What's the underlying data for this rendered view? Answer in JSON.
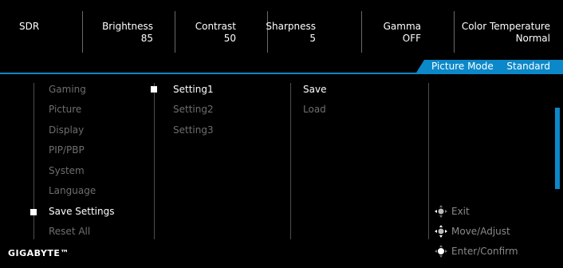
{
  "top_bar": {
    "sdr": "SDR",
    "items": [
      {
        "label": "Brightness",
        "value": "85"
      },
      {
        "label": "Contrast",
        "value": "50"
      },
      {
        "label": "Sharpness",
        "value": "5"
      },
      {
        "label": "Gamma",
        "value": "OFF"
      },
      {
        "label": "Color Temperature",
        "value": "Normal"
      }
    ]
  },
  "picture_mode": {
    "label": "Picture Mode",
    "value": "Standard"
  },
  "main_menu": {
    "items": [
      "Gaming",
      "Picture",
      "Display",
      "PIP/PBP",
      "System",
      "Language",
      "Save Settings",
      "Reset All"
    ],
    "selected": "Save Settings"
  },
  "sub_menu": {
    "items": [
      "Setting1",
      "Setting2",
      "Setting3"
    ],
    "selected": "Setting1"
  },
  "actions": {
    "items": [
      "Save",
      "Load"
    ],
    "selected": "Save"
  },
  "hints": {
    "exit": "Exit",
    "move": "Move/Adjust",
    "enter": "Enter/Confirm"
  },
  "brand": "GIGABYTE™",
  "colors": {
    "accent": "#0b88c9",
    "inactive_text": "#6e6e6e",
    "active_text": "#ffffff",
    "background": "#000000"
  },
  "icons": {
    "joystick": "joystick-icon"
  }
}
